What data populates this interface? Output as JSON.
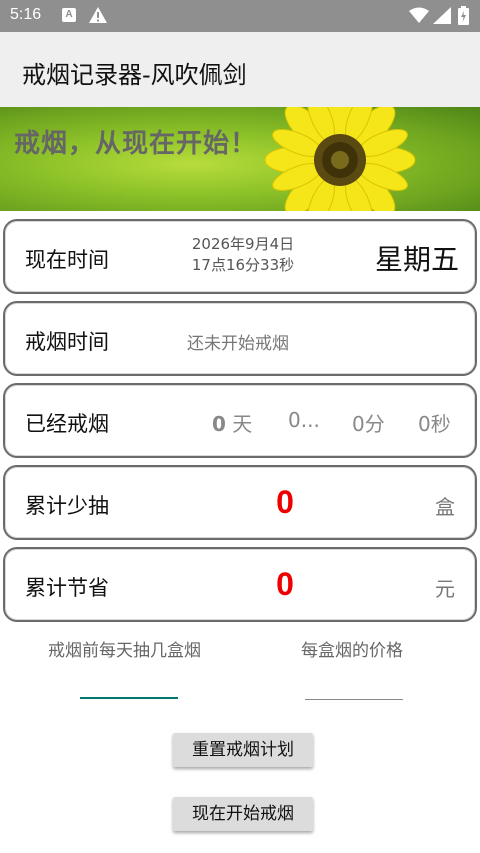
{
  "status_bar": {
    "time": "5:16",
    "icons": [
      "notification-a-icon",
      "warning-icon",
      "wifi-icon",
      "signal-icon",
      "battery-icon"
    ]
  },
  "app_bar": {
    "title": "戒烟记录器-风吹佩剑"
  },
  "banner": {
    "text": "戒烟，从现在开始！"
  },
  "now_card": {
    "label": "现在时间",
    "date_line1": "2026年9月4日",
    "date_line2": "17点16分33秒",
    "weekday": "星期五"
  },
  "quit_time_card": {
    "label": "戒烟时间",
    "status": "还未开始戒烟"
  },
  "elapsed_card": {
    "label": "已经戒烟",
    "days_value": "0",
    "days_unit": "天",
    "hours_text": "0...",
    "minutes_text": "0分",
    "seconds_text": "0秒"
  },
  "saved_boxes_card": {
    "label": "累计少抽",
    "value": "0",
    "unit": "盒"
  },
  "saved_money_card": {
    "label": "累计节省",
    "value": "0",
    "unit": "元"
  },
  "inputs": {
    "boxes_per_day_hint": "戒烟前每天抽几盒烟",
    "price_per_box_hint": "每盒烟的价格"
  },
  "buttons": {
    "reset_label": "重置戒烟计划",
    "start_label": "现在开始戒烟"
  },
  "colors": {
    "status_bar": "#8f8f8f",
    "app_bar": "#efefef",
    "accent_teal": "#00796b",
    "highlight_red": "#ee0000",
    "button_bg": "#dcdcdc"
  }
}
